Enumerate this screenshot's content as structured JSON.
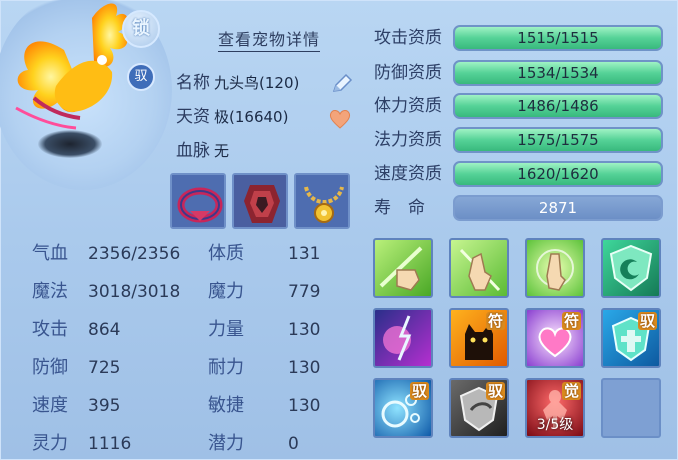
{
  "pet_panel": {
    "lock_badge": "锁",
    "bind_badge": "驭",
    "detail_link": "查看宠物详情",
    "name_label": "名称",
    "name_value": "九头鸟(120)",
    "talent_label": "天资",
    "talent_value": "极(16640)",
    "bloodline_label": "血脉",
    "bloodline_value": "无",
    "equipment": [
      {
        "name": "collar-equipment",
        "icon": "collar-icon"
      },
      {
        "name": "armor-equipment",
        "icon": "armor-icon"
      },
      {
        "name": "amulet-equipment",
        "icon": "amulet-icon"
      }
    ]
  },
  "stats": [
    {
      "label": "气血",
      "value": "2356/2356"
    },
    {
      "label": "魔法",
      "value": "3018/3018"
    },
    {
      "label": "攻击",
      "value": "864"
    },
    {
      "label": "防御",
      "value": "725"
    },
    {
      "label": "速度",
      "value": "395"
    },
    {
      "label": "灵力",
      "value": "1116"
    }
  ],
  "attributes": [
    {
      "label": "体质",
      "value": "131"
    },
    {
      "label": "魔力",
      "value": "779"
    },
    {
      "label": "力量",
      "value": "130"
    },
    {
      "label": "耐力",
      "value": "130"
    },
    {
      "label": "敏捷",
      "value": "130"
    },
    {
      "label": "潜力",
      "value": "0"
    }
  ],
  "aptitudes": [
    {
      "label": "攻击资质",
      "value": "1515/1515"
    },
    {
      "label": "防御资质",
      "value": "1534/1534"
    },
    {
      "label": "体力资质",
      "value": "1486/1486"
    },
    {
      "label": "法力资质",
      "value": "1575/1575"
    },
    {
      "label": "速度资质",
      "value": "1620/1620"
    }
  ],
  "lifespan": {
    "label": "寿　命",
    "value": "2871"
  },
  "skills": {
    "tags": [
      "符",
      "符",
      "驭",
      "驭",
      "驭",
      "觉"
    ],
    "awaken_level": "3/5级"
  },
  "colors": {
    "aptitude_bar": "#55d297",
    "panel_bg": "#a9c9ec",
    "skill_border": "#5f83bd"
  }
}
